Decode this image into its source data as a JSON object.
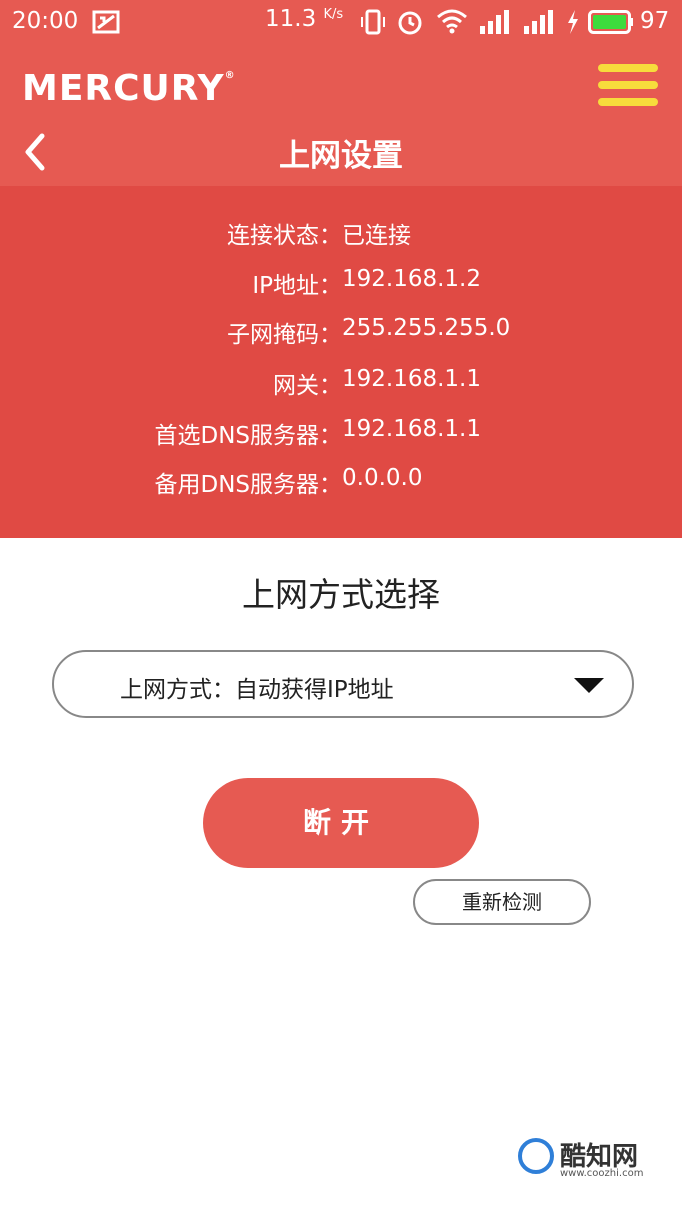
{
  "statusbar": {
    "time": "20:00",
    "speed": "11.3",
    "speed_unit": "K/s",
    "battery": "97"
  },
  "header": {
    "logo": "MERCURY",
    "title": "上网设置"
  },
  "info": [
    {
      "label": "连接状态：",
      "value": "已连接"
    },
    {
      "label": "IP地址：",
      "value": "192.168.1.2"
    },
    {
      "label": "子网掩码：",
      "value": "255.255.255.0"
    },
    {
      "label": "网关：",
      "value": "192.168.1.1"
    },
    {
      "label": "首选DNS服务器：",
      "value": "192.168.1.1"
    },
    {
      "label": "备用DNS服务器：",
      "value": "0.0.0.0"
    }
  ],
  "section_title": "上网方式选择",
  "select": {
    "label": "上网方式：",
    "value": "自动获得IP地址"
  },
  "buttons": {
    "disconnect": "断开",
    "redetect": "重新检测"
  },
  "watermark": {
    "name": "酷知网",
    "url": "www.coozhi.com"
  },
  "colors": {
    "header_red": "#e65a52",
    "panel_red": "#e04a44",
    "menu_yellow": "#f7dc3c"
  }
}
